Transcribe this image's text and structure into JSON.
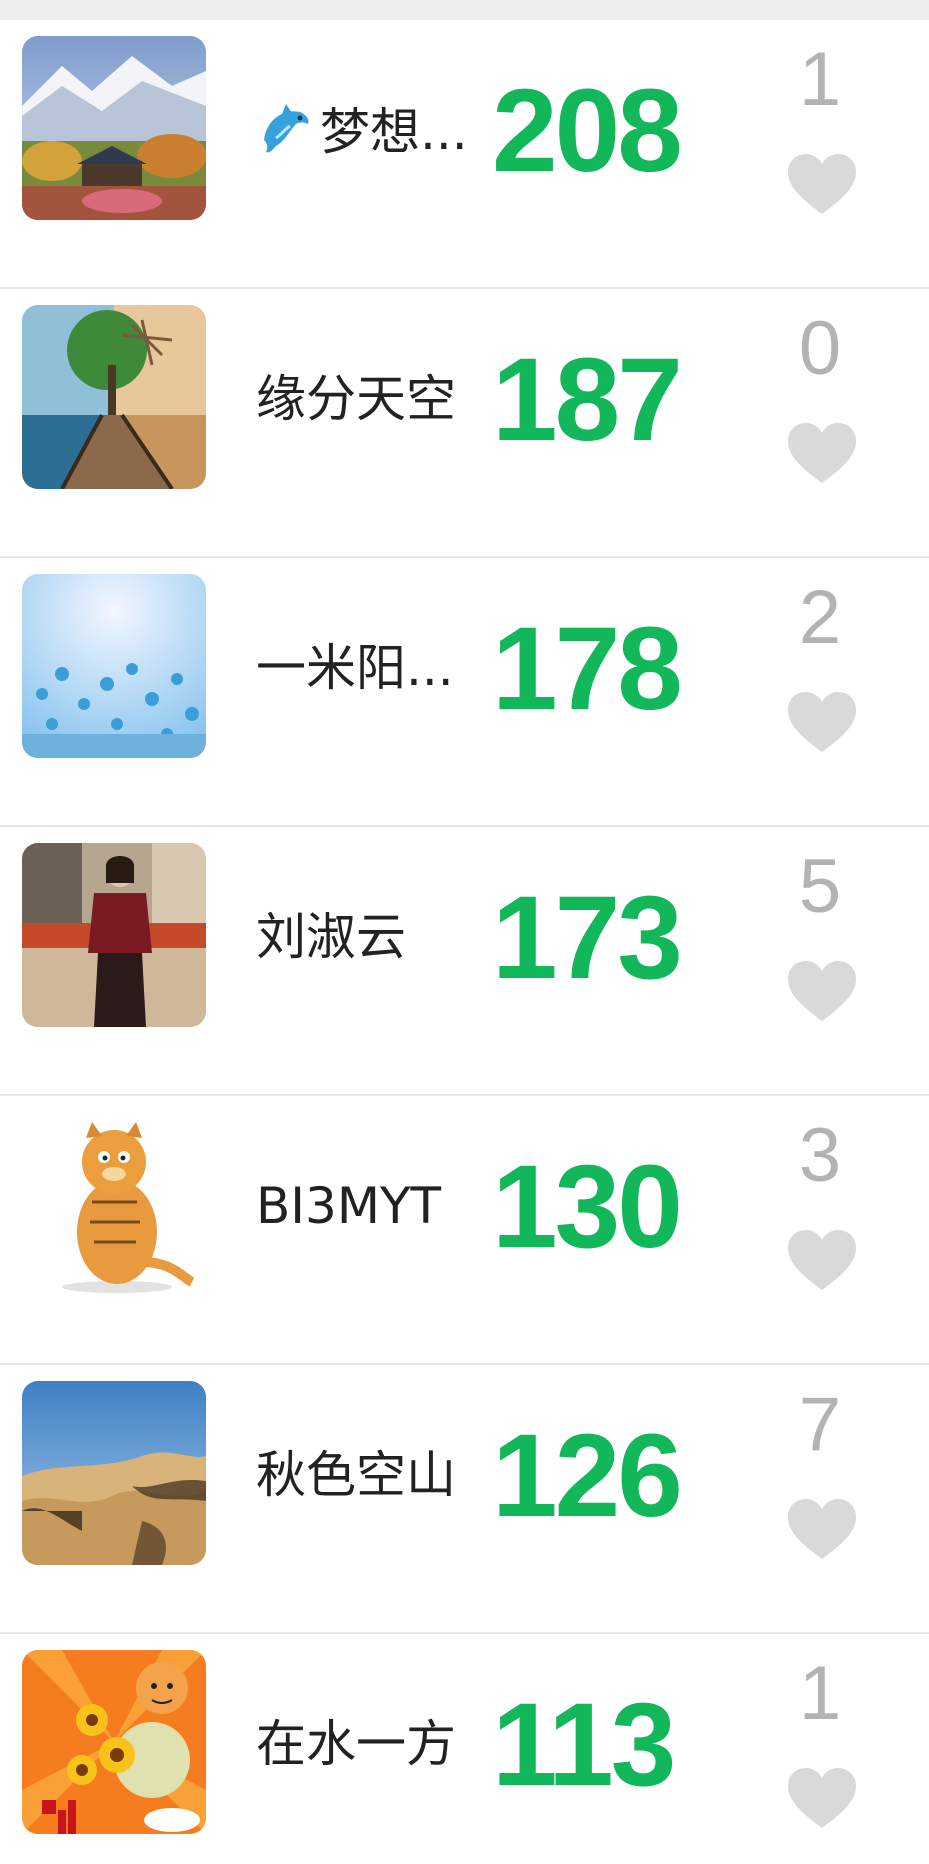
{
  "colors": {
    "steps": "#12b75a",
    "likes": "#b3b3b3",
    "heart": "#d9d9d9",
    "name": "#222222",
    "background": "#ffffff",
    "divider": "#e9e9e9"
  },
  "ranking": [
    {
      "name": "梦想...",
      "steps": "208",
      "likes": "1",
      "avatar": "snowy-mountain-village-photo",
      "name_prefix_icon": "dolphin-icon"
    },
    {
      "name": "缘分天空",
      "steps": "187",
      "likes": "0",
      "avatar": "boardwalk-sea-tree-photo"
    },
    {
      "name": "一米阳...",
      "steps": "178",
      "likes": "2",
      "avatar": "blue-flowers-photo"
    },
    {
      "name": "刘淑云",
      "steps": "173",
      "likes": "5",
      "avatar": "woman-portrait-photo"
    },
    {
      "name": "BI3MYT",
      "steps": "130",
      "likes": "3",
      "avatar": "garfield-cat-image"
    },
    {
      "name": "秋色空山",
      "steps": "126",
      "likes": "7",
      "avatar": "desert-dunes-photo"
    },
    {
      "name": "在水一方",
      "steps": "113",
      "likes": "1",
      "avatar": "sunflower-tiger-card"
    }
  ]
}
